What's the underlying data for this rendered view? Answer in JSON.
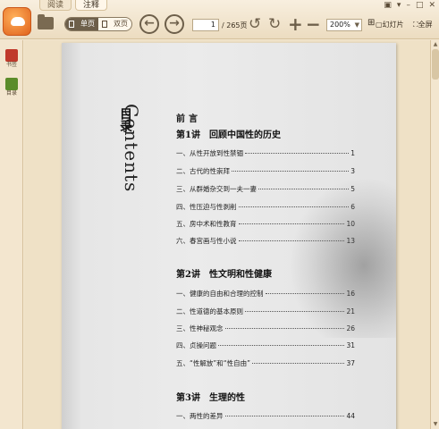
{
  "tabs": [
    "阅读",
    "注释"
  ],
  "toolbar": {
    "view_single": "单页",
    "view_double": "双页",
    "page_current": "1",
    "page_total": "/ 265页",
    "zoom": "200%",
    "slideshow": "幻灯片",
    "fullscreen": "全屏"
  },
  "sidebar": [
    {
      "label": "书签",
      "color": "#c0392b"
    },
    {
      "label": "目录",
      "color": "#5b8c2a"
    }
  ],
  "document": {
    "vertical_en": "Contents",
    "vertical_zh": "目录",
    "preface": "前言",
    "chapters": [
      {
        "title": "第1讲　回顾中国性的历史",
        "entries": [
          {
            "text": "一、从性开放到性禁锢",
            "page": "1"
          },
          {
            "text": "二、古代的性崇拜",
            "page": "3"
          },
          {
            "text": "三、从群婚杂交到一夫一妻",
            "page": "5"
          },
          {
            "text": "四、性压迫与性剥削",
            "page": "6"
          },
          {
            "text": "五、房中术和性教育",
            "page": "10"
          },
          {
            "text": "六、春宫画与性小说",
            "page": "13"
          }
        ]
      },
      {
        "title": "第2讲　性文明和性健康",
        "entries": [
          {
            "text": "一、健康的自由和合理的控制",
            "page": "16"
          },
          {
            "text": "二、性道德的基本原则",
            "page": "21"
          },
          {
            "text": "三、性神秘观念",
            "page": "26"
          },
          {
            "text": "四、贞操问题",
            "page": "31"
          },
          {
            "text": "五、“性解放”和“性自由”",
            "page": "37"
          }
        ]
      },
      {
        "title": "第3讲　生理的性",
        "entries": [
          {
            "text": "一、两性的差异",
            "page": "44"
          }
        ]
      }
    ]
  }
}
